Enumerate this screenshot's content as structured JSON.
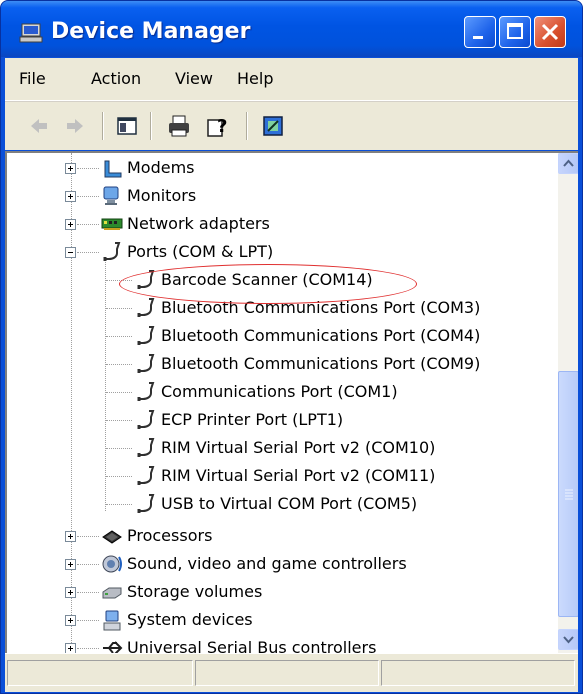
{
  "window": {
    "title": "Device Manager",
    "title_color": "#0054e3"
  },
  "menu": {
    "items": [
      "File",
      "Action",
      "View",
      "Help"
    ]
  },
  "toolbar": {
    "buttons": [
      "back-icon",
      "forward-icon",
      "show-hide-console-tree-icon",
      "print-icon",
      "help-icon",
      "properties-icon"
    ]
  },
  "tree": {
    "modems": "Modems",
    "monitors": "Monitors",
    "network_adapters": "Network adapters",
    "ports": "Ports (COM & LPT)",
    "ports_children": [
      "Barcode Scanner (COM14)",
      "Bluetooth Communications Port (COM3)",
      "Bluetooth Communications Port (COM4)",
      "Bluetooth Communications Port (COM9)",
      "Communications Port (COM1)",
      "ECP Printer Port (LPT1)",
      "RIM Virtual Serial Port v2 (COM10)",
      "RIM Virtual Serial Port v2 (COM11)",
      "USB to Virtual COM Port (COM5)"
    ],
    "processors": "Processors",
    "sound": "Sound, video and game controllers",
    "storage": "Storage volumes",
    "system": "System devices",
    "usb": "Universal Serial Bus controllers"
  },
  "highlight_color": "#e03030"
}
